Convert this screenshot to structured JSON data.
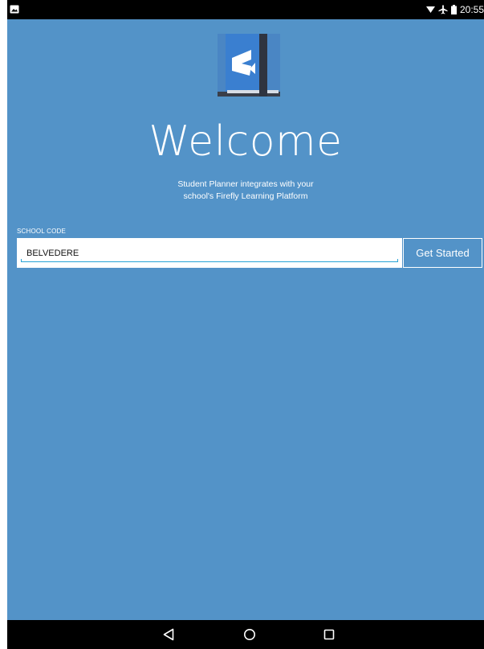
{
  "status_bar": {
    "time": "20:55",
    "icons": [
      "photo-notification-icon",
      "wifi-icon",
      "airplane-mode-icon",
      "battery-icon"
    ]
  },
  "app": {
    "logo_icon": "student-planner-book-icon",
    "title": "Welcome",
    "subtitle_line1": "Student Planner integrates with your",
    "subtitle_line2": "school's Firefly Learning Platform"
  },
  "form": {
    "school_code_label": "SCHOOL CODE",
    "school_code_value": "BELVEDERE",
    "submit_label": "Get Started"
  },
  "nav_bar": {
    "icons": [
      "back-icon",
      "home-icon",
      "recents-icon"
    ]
  },
  "colors": {
    "background": "#5393c8",
    "accent_underline": "#29a3d6",
    "text": "#ffffff",
    "bars": "#000000"
  }
}
